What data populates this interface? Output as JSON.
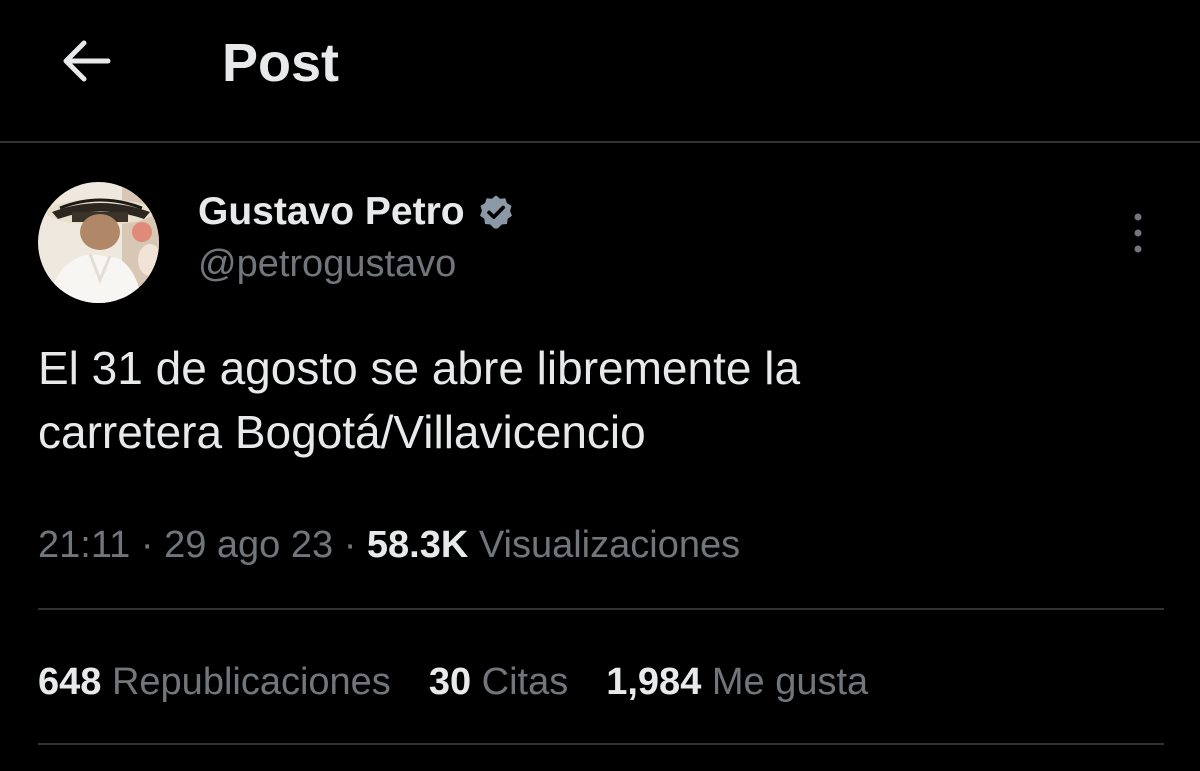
{
  "header": {
    "back_icon": "arrow-left-icon",
    "title": "Post"
  },
  "author": {
    "name": "Gustavo Petro",
    "handle": "@petrogustavo",
    "verified_icon": "verified-badge-icon",
    "verified_color": "#8b98a5"
  },
  "more_icon": "more-vertical-icon",
  "post": {
    "text_line1": "El 31 de agosto se abre libremente la",
    "text_line2": "carretera Bogotá/Villavicencio"
  },
  "meta": {
    "time": "21:11",
    "separator": "·",
    "date": "29 ago 23",
    "views_count": "58.3K",
    "views_label": "Visualizaciones"
  },
  "stats": {
    "reposts_count": "648",
    "reposts_label": "Republicaciones",
    "quotes_count": "30",
    "quotes_label": "Citas",
    "likes_count": "1,984",
    "likes_label": "Me gusta"
  },
  "colors": {
    "background": "#000000",
    "text_primary": "#e7e9ea",
    "text_secondary": "#71767b",
    "divider": "#2f3336"
  }
}
